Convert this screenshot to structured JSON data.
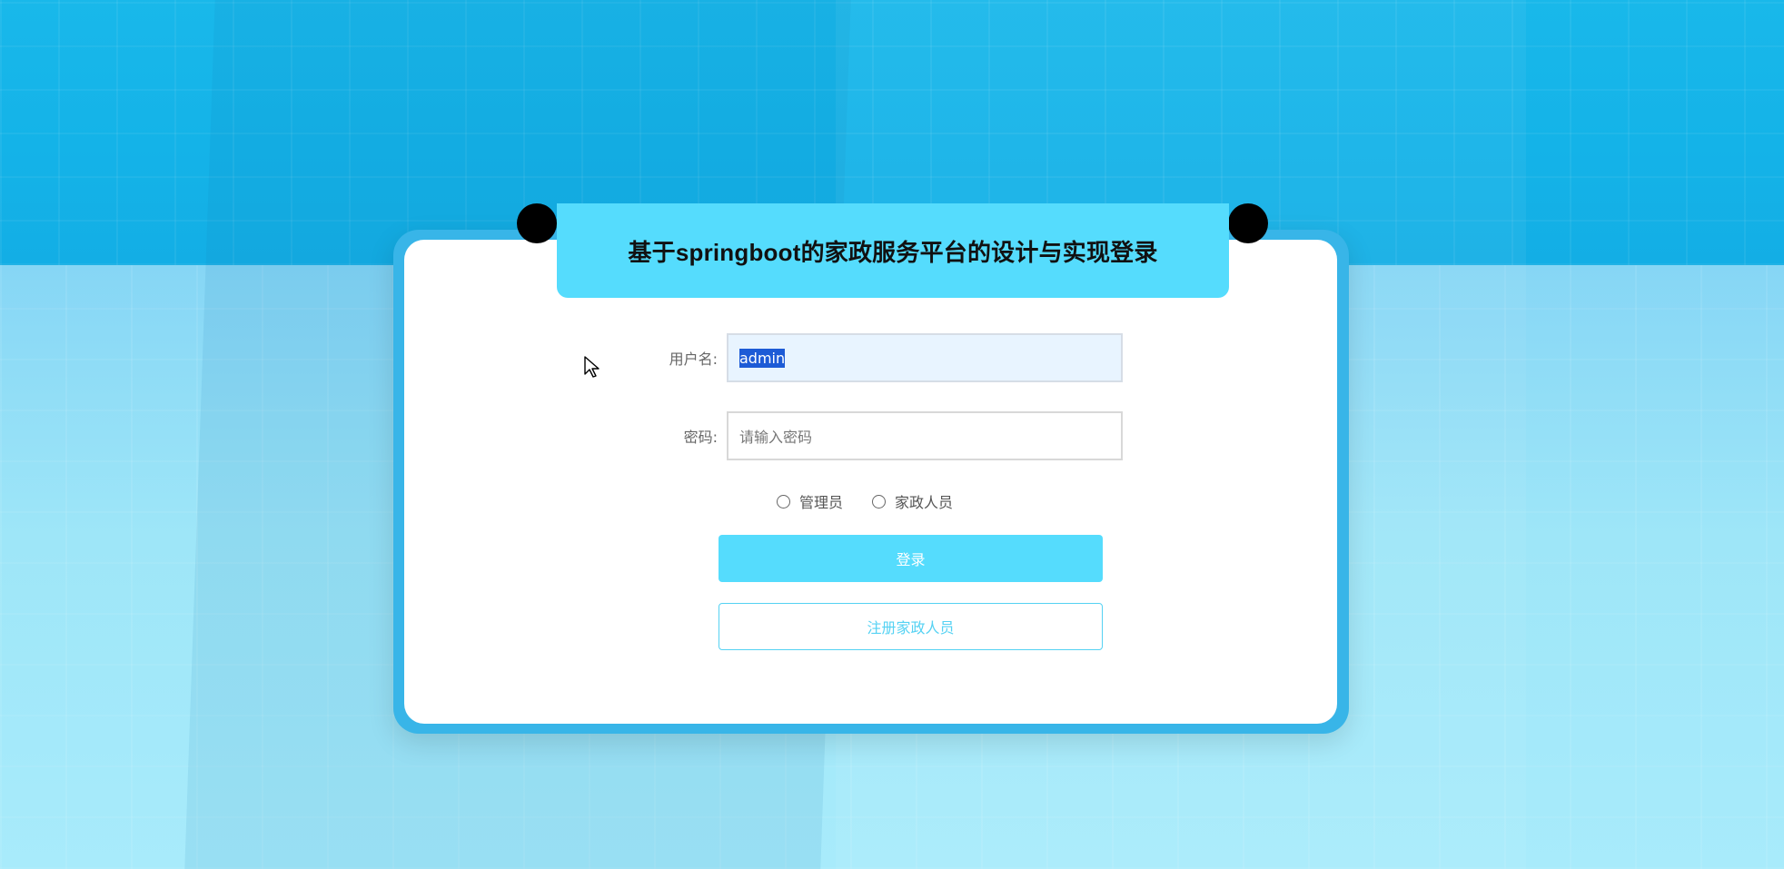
{
  "page": {
    "title": "基于springboot的家政服务平台的设计与实现登录"
  },
  "form": {
    "username": {
      "label": "用户名:",
      "value": "admin"
    },
    "password": {
      "label": "密码:",
      "placeholder": "请输入密码",
      "value": ""
    },
    "roles": [
      {
        "label": "管理员",
        "selected": false
      },
      {
        "label": "家政人员",
        "selected": false
      }
    ]
  },
  "buttons": {
    "login_label": "登录",
    "register_label": "注册家政人员"
  },
  "colors": {
    "accent": "#55dcfd",
    "card_border": "#38b5e8",
    "background_top": "#19b8ea",
    "background_bottom": "#9ee6f8"
  },
  "icons": {
    "cursor": "mouse-pointer-icon"
  }
}
